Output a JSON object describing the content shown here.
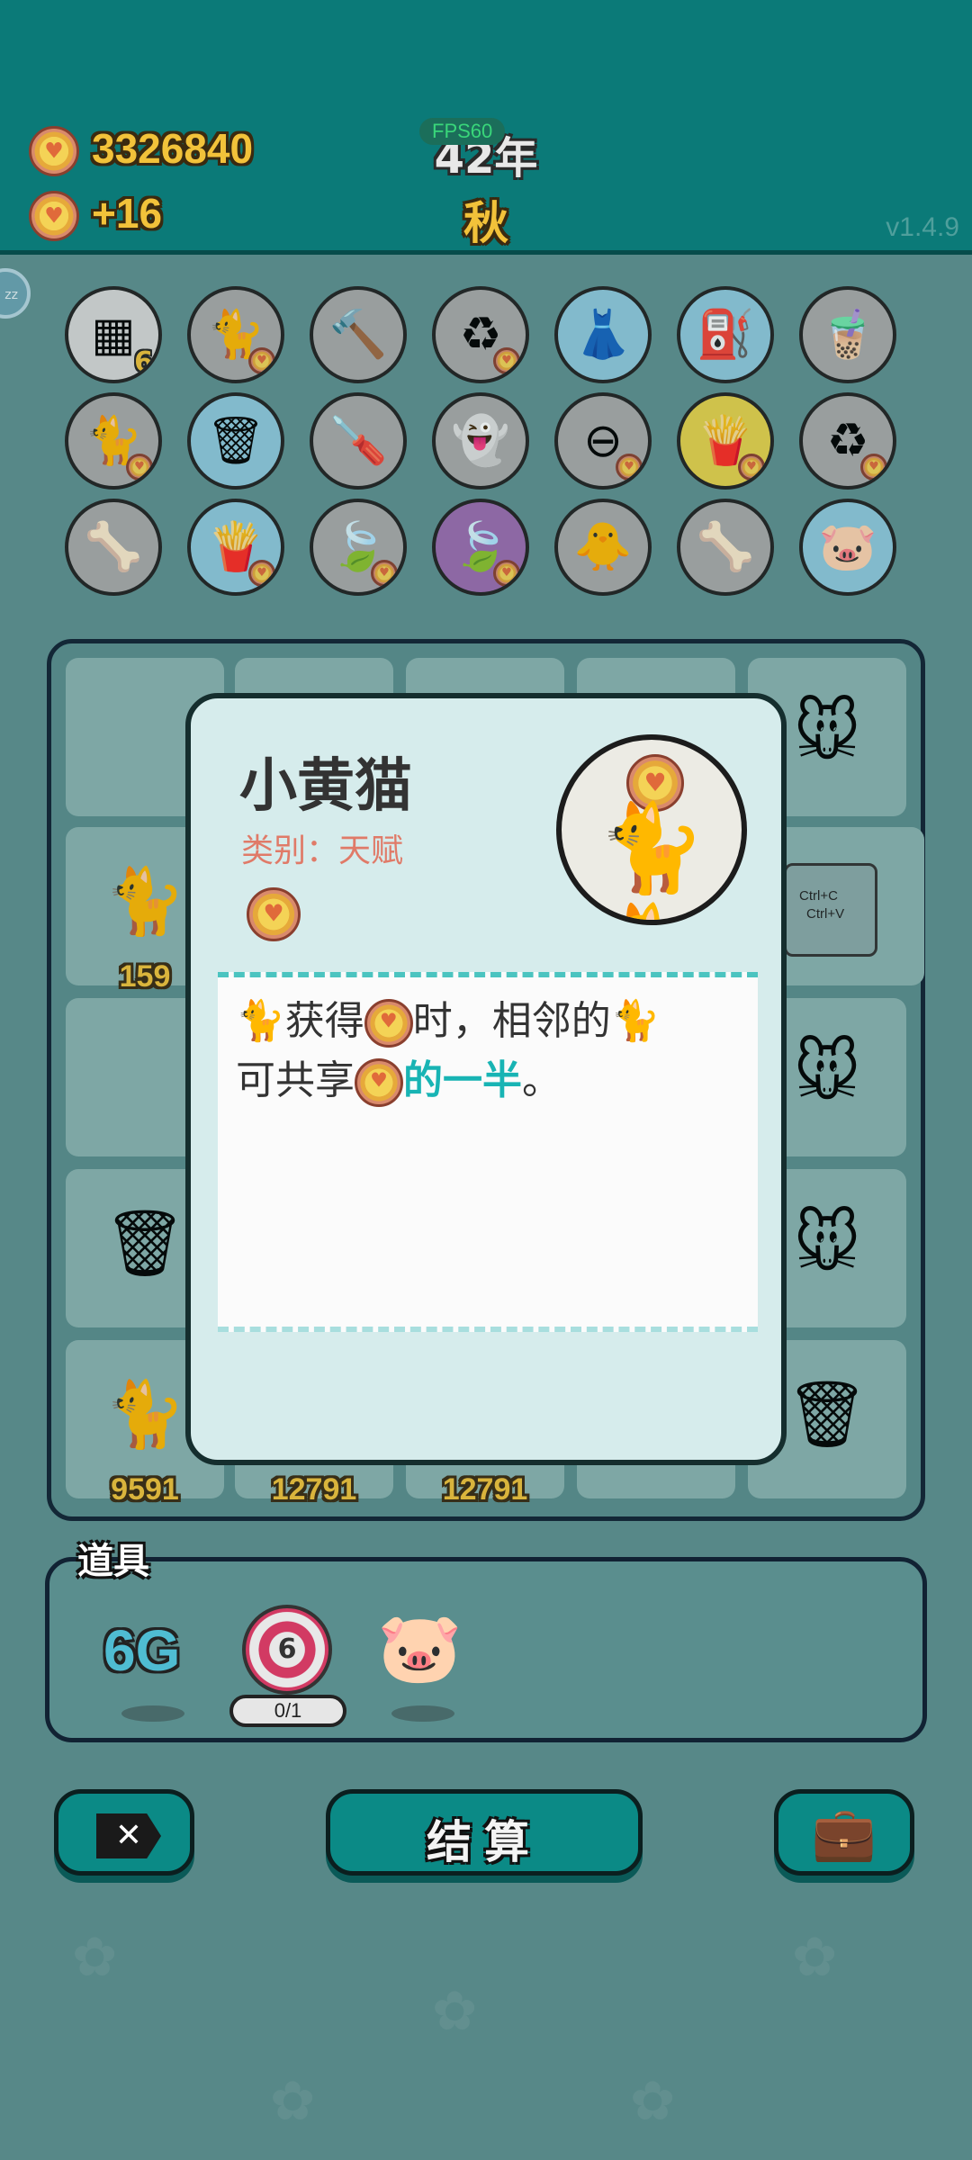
{
  "header": {
    "money": "3326840",
    "income": "+16",
    "year": "42年",
    "season": "秋",
    "fps": "FPS60",
    "version": "v1.4.9",
    "sleep_badge": "zz"
  },
  "items": [
    {
      "name": "egg-tray-item",
      "glyph": "▦",
      "bg": "#d8d8d8",
      "count": "6",
      "coin": false
    },
    {
      "name": "cat-hole-item",
      "glyph": "🐈",
      "bg": "#a9a9a9",
      "coin": true
    },
    {
      "name": "hammer-item",
      "glyph": "🔨",
      "bg": "#a9a9a9",
      "coin": false
    },
    {
      "name": "recycle-arrows-item",
      "glyph": "♻",
      "bg": "#a9a9a9",
      "coin": true
    },
    {
      "name": "skirt-item",
      "glyph": "👗",
      "bg": "#8fc9dd",
      "coin": false
    },
    {
      "name": "air-pump-item",
      "glyph": "⛽",
      "bg": "#8fc9dd",
      "coin": false
    },
    {
      "name": "bubble-tea-item",
      "glyph": "🧋",
      "bg": "#a9a9a9",
      "coin": false
    },
    {
      "name": "yellow-cats-item",
      "glyph": "🐈",
      "bg": "#a9a9a9",
      "coin": true
    },
    {
      "name": "trash-bag-item",
      "glyph": "🗑",
      "bg": "#8fc9dd",
      "coin": false
    },
    {
      "name": "screwdriver-item",
      "glyph": "🪛",
      "bg": "#a9a9a9",
      "coin": false
    },
    {
      "name": "ghost-item",
      "glyph": "👻",
      "bg": "#a9a9a9",
      "coin": false
    },
    {
      "name": "minus-item",
      "glyph": "⊖",
      "bg": "#a9a9a9",
      "coin": true
    },
    {
      "name": "fries-item",
      "glyph": "🍟",
      "bg": "#e6d24a",
      "coin": true
    },
    {
      "name": "recycle-item",
      "glyph": "♻",
      "bg": "#a9a9a9",
      "coin": true
    },
    {
      "name": "pet-food-item",
      "glyph": "🦴",
      "bg": "#a9a9a9",
      "coin": false
    },
    {
      "name": "fries-item-2",
      "glyph": "🍟",
      "bg": "#8fc9dd",
      "coin": true
    },
    {
      "name": "leaf-item",
      "glyph": "🍃",
      "bg": "#a9a9a9",
      "coin": true
    },
    {
      "name": "purple-leaf-item",
      "glyph": "🍃",
      "bg": "#9b6bb0",
      "coin": true
    },
    {
      "name": "chick-egg-item",
      "glyph": "🐥",
      "bg": "#a9a9a9",
      "coin": false
    },
    {
      "name": "pet-food-item-2",
      "glyph": "🦴",
      "bg": "#a9a9a9",
      "coin": false
    },
    {
      "name": "piggy-bank-item",
      "glyph": "🐷",
      "bg": "#8fc9dd",
      "coin": false
    }
  ],
  "board": {
    "cells": [
      {
        "name": "cell-r1-c5-mouse",
        "glyph": "🐭",
        "number": ""
      },
      {
        "name": "cell-r2-c1-cat",
        "glyph": "🐈",
        "number": "159"
      },
      {
        "name": "cell-r3-c5-mouse",
        "glyph": "🐭",
        "number": ""
      },
      {
        "name": "cell-r4-c1-trash",
        "glyph": "🗑",
        "number": ""
      },
      {
        "name": "cell-r4-c5-mouse",
        "glyph": "🐭",
        "number": ""
      },
      {
        "name": "cell-r5-c1-cat",
        "glyph": "🐈",
        "number": "9591"
      },
      {
        "name": "cell-r5-c2",
        "glyph": "",
        "number": "12791"
      },
      {
        "name": "cell-r5-c3",
        "glyph": "",
        "number": "12791"
      },
      {
        "name": "cell-r5-c5-trash",
        "glyph": "🗑",
        "number": ""
      }
    ],
    "ctrl_line1": "Ctrl+C",
    "ctrl_line2": "Ctrl+V"
  },
  "modal": {
    "title": "小黄猫",
    "category": "类别：天赋",
    "desc_part1": "获得",
    "desc_part2": "时，相邻的",
    "desc_part3": "可共享",
    "desc_highlight": "的一半",
    "desc_end": "。"
  },
  "tools": {
    "label": "道具",
    "g6": "6G",
    "target_value": "6",
    "target_count": "0/1"
  },
  "buttons": {
    "settle": "结算"
  },
  "colors": {
    "header_bg": "#0b7a78",
    "accent_teal": "#18b4b4",
    "coin_gold": "#f2c23a",
    "category_pink": "#e07a68"
  }
}
